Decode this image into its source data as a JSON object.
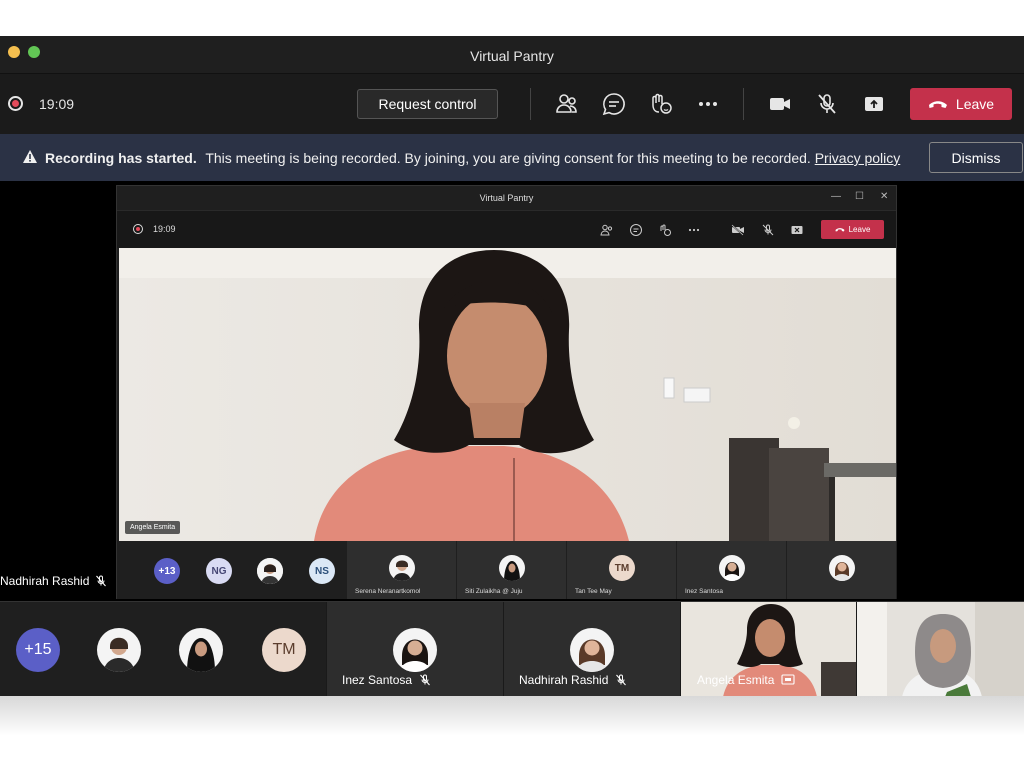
{
  "window": {
    "title": "Virtual Pantry"
  },
  "toolbar": {
    "timer": "19:09",
    "request_control_label": "Request control",
    "leave_label": "Leave"
  },
  "banner": {
    "heading": "Recording has started.",
    "message": "This meeting is being recorded. By joining, you are giving consent for this meeting to be recorded.",
    "link": "Privacy policy",
    "dismiss_label": "Dismiss"
  },
  "stage": {
    "left_participant": "Nadhirah Rashid"
  },
  "shared": {
    "title": "Virtual Pantry",
    "timer": "19:09",
    "leave_label": "Leave",
    "speaker_name": "Angela Esmita",
    "overflow_count": "+13",
    "avatars": [
      "NG",
      "NS"
    ],
    "tiles": [
      {
        "name": "Serena Neranartkomol"
      },
      {
        "name": "Siti Zulaikha @ Juju"
      },
      {
        "name": "Tan Tee May",
        "initials": "TM"
      },
      {
        "name": "Inez Santosa"
      }
    ]
  },
  "bottom": {
    "overflow_count": "+15",
    "initials_tm": "TM",
    "tiles": [
      {
        "name": "Inez Santosa"
      },
      {
        "name": "Nadhirah Rashid"
      },
      {
        "name": "Angela Esmita"
      }
    ]
  },
  "colors": {
    "leave": "#c4314b",
    "banner": "#2b3245",
    "overflow": "#5b5fc7"
  }
}
